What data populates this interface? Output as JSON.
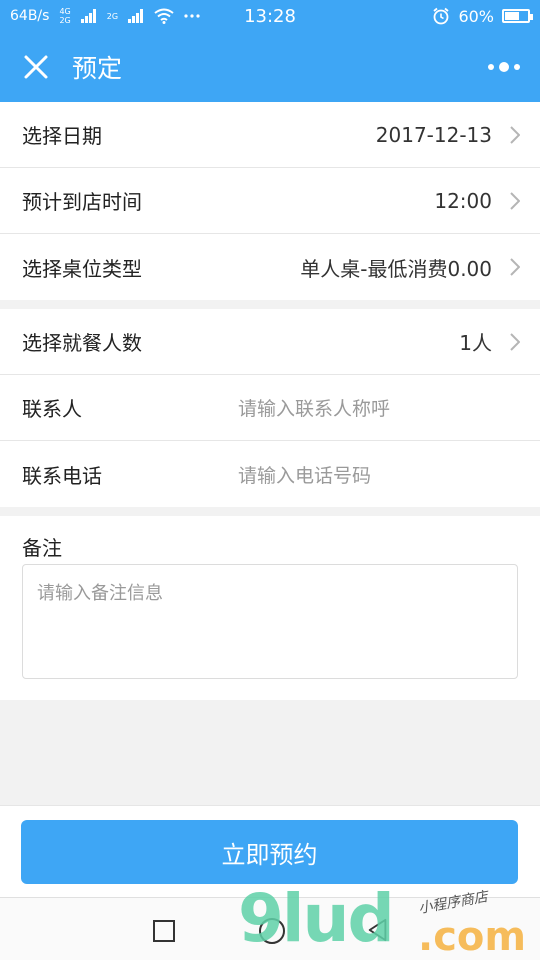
{
  "status_bar": {
    "net_speed": "64B/s",
    "net_4g": "4G",
    "net_2g": "2G",
    "net_2g_b": "2G",
    "time": "13:28",
    "battery_level": "60%",
    "battery_fraction": 0.6
  },
  "header": {
    "title": "预定"
  },
  "rows_a": [
    {
      "label": "选择日期",
      "value": "2017-12-13"
    },
    {
      "label": "预计到店时间",
      "value": "12:00"
    },
    {
      "label": "选择桌位类型",
      "value": "单人桌-最低消费0.00"
    }
  ],
  "rows_b": [
    {
      "label": "选择就餐人数",
      "value": "1人"
    }
  ],
  "contact": {
    "name_label": "联系人",
    "name_placeholder": "请输入联系人称呼",
    "phone_label": "联系电话",
    "phone_placeholder": "请输入电话号码"
  },
  "note": {
    "label": "备注",
    "placeholder": "请输入备注信息"
  },
  "submit": {
    "label": "立即预约"
  },
  "watermark": {
    "main": "9lud",
    "domain": ".com",
    "tag": "小程序商店"
  },
  "colors": {
    "accent": "#3ea6f5",
    "placeholder": "#9a9a9a"
  }
}
